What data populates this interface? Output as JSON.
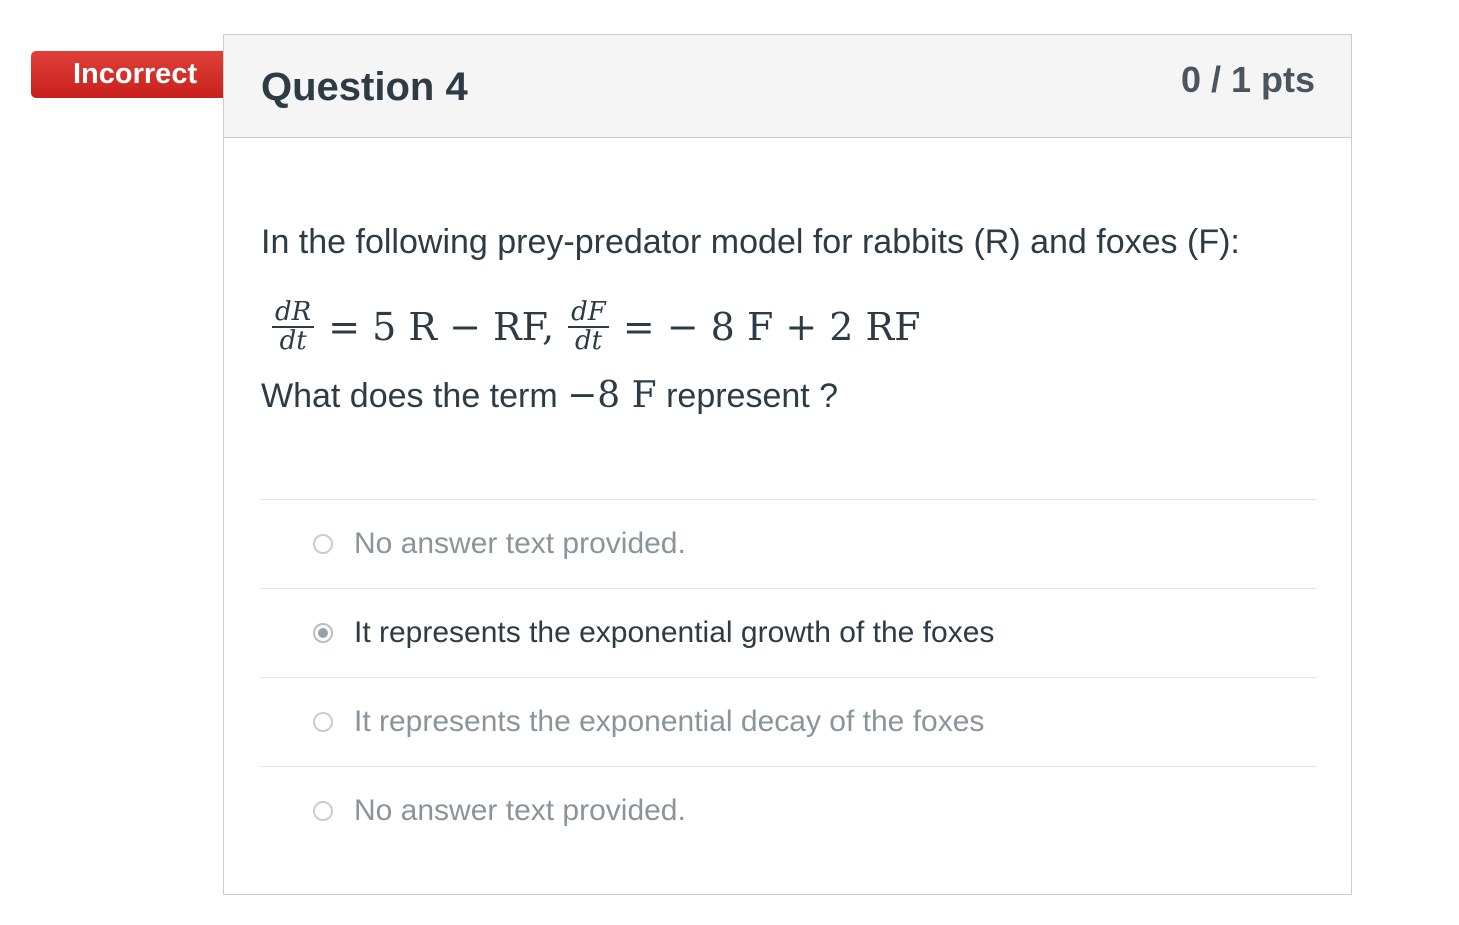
{
  "flag": {
    "label": "Incorrect",
    "color": "#d12e28"
  },
  "question": {
    "title": "Question 4",
    "points": "0 / 1 pts",
    "text": "In the following prey-predator model for rabbits (R) and foxes (F):",
    "equation": {
      "frac1_num": "dR",
      "frac1_den": "dt",
      "part1": "= 5 R  −  RF,",
      "frac2_num": "dF",
      "frac2_den": "dt",
      "part2": "= − 8 F + 2 RF"
    },
    "sub_prefix": "What does the term ",
    "sub_math": "−8 F",
    "sub_suffix": " represent ?"
  },
  "answers": [
    {
      "label": "No answer text provided.",
      "selected": false
    },
    {
      "label": "It represents the exponential growth of the foxes",
      "selected": true
    },
    {
      "label": "It represents the exponential decay of the foxes",
      "selected": false
    },
    {
      "label": "No answer text provided.",
      "selected": false
    }
  ]
}
